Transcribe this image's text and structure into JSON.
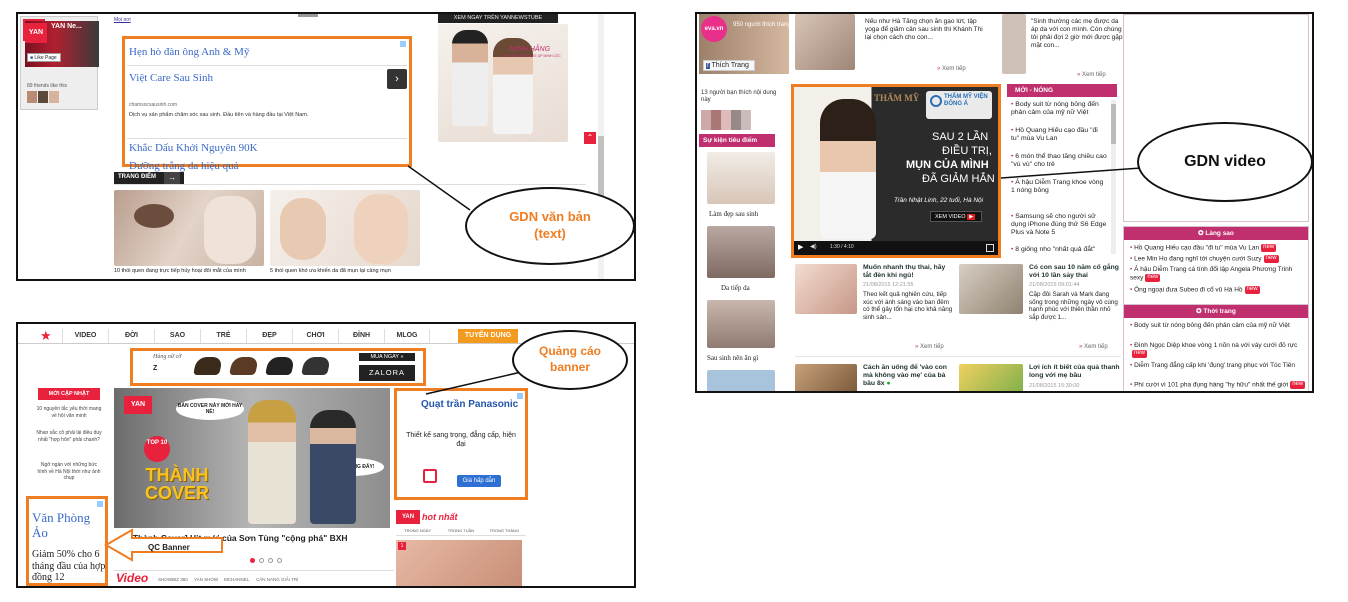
{
  "p1": {
    "fb_name": "YAN Ne...",
    "like_label": "Like Page",
    "friends": "89 friends like this",
    "top_link": "Mọi nơi",
    "banner_text": "XEM NGAY TRÊN YANNEWSTUBE",
    "ad_items": [
      "Hẹn hò đàn ông Anh & Mỹ",
      "Việt Care Sau Sinh",
      "Khắc Dấu Khởi Nguyên 90K",
      "Dưỡng trắng da hiệu quả"
    ],
    "ad_url": "chamsocsausinh.com",
    "ad_desc": "Dịch vụ sản phẩm chăm sóc sau sinh. Đầu tiên và hàng đầu tại Việt Nam.",
    "promo_name": "MINH HẰNG",
    "promo_sub": "CHUYÊN VIÊN MAKE UP MINH LỘC",
    "section": "TRANG ĐIỂM",
    "article1": "10 thói quen đang trực tiếp hủy hoại đôi mắt của mình",
    "article2": "5 thói quen khó ưa khiến da đã mụn lại càng mụn",
    "callout": "GDN văn bản (text)"
  },
  "p2": {
    "logo": "eva.vn",
    "follow": "950 người thích trang",
    "like_btn": "Thích Trang",
    "likes_text": "13 người bạn thích nội dung này",
    "top_text1": "Nếu như Hà Tăng chọn ăn gạo lứt, tập yoga để giảm cân sau sinh thì Khánh Thi lại chọn cách cho con...",
    "top_text2": "\"Sinh thường các mẹ được da áp da với con mình. Còn chúng tôi phải đợi 2 giờ mới được gặp mặt con...",
    "see_more": "Xem tiếp",
    "side_head": "Sự kiện tiêu điểm",
    "side_items": [
      "Làm đẹp sau sinh",
      "Da tiếp da",
      "Sau sinh nên ăn gì"
    ],
    "video_brand": "THẨM MỸ VIỆN ĐÔNG Á",
    "video_lines": [
      "SAU 2 LẦN",
      "ĐIỀU TRỊ,",
      "MỤN CỦA MÌNH",
      "ĐÃ GIẢM HẲN"
    ],
    "video_name": "Trần Nhật Linh, 22 tuổi, Hà Nội",
    "video_btn": "XEM VIDEO",
    "video_time": "1:30 / 4:10",
    "news_head": "MỚI - NÓNG",
    "news": [
      "Body suit từ nóng bỏng đến phản cảm của mỹ nữ Việt",
      "Hồ Quang Hiếu cạo đầu \"đi tu\" mùa Vu Lan",
      "6 món thể thao tăng chiều cao \"vù vù\" cho trẻ",
      "Á hậu Diễm Trang khoe vòng 1 nóng bỏng",
      "Samsung sẽ cho người sử dụng iPhone đúng thử S6 Edge Plus và Note 5",
      "8 giống nho \"nhất quả đắt\""
    ],
    "bottom_titles": [
      "Muốn nhanh thụ thai, hãy tắt đèn khi ngủ!",
      "Có con sau 10 năm cố gắng với 10 lần sảy thai",
      "Cách ăn uống để 'vào con mà không vào mẹ' của bà bầu 8x",
      "Lợi ích ít biết của quả thanh long với mẹ bầu"
    ],
    "bottom_dates": [
      "21/08/2015 12:21:55",
      "21/08/2015 09:01:44",
      "21/08/2015 15:30:00",
      "21/08/2015 15:30:00"
    ],
    "bottom_descs": [
      "Theo kết quả nghiên cứu, tiếp xúc với ánh sáng vào ban đêm có thể gây tổn hại cho khả năng sinh sản...",
      "Cặp đôi Sarah và Mark đang sống trong những ngày vô cùng hạnh phúc với thiên thần nhỏ sắp được 1..."
    ],
    "box1_head": "Làng sao",
    "box1_items": [
      "Hồ Quang Hiếu cạo đầu \"đi tu\" mùa Vu Lan",
      "Lee Min Ho đang nghĩ tới chuyện cưới Suzy",
      "Á hậu Diễm Trang cá tính đổi lập Angela Phương Trinh sexy",
      "Ông ngoại đưa Subeo đi cổ vũ Hà Hồ"
    ],
    "box2_head": "Thời trang",
    "box2_items": [
      "Body suit từ nóng bỏng đến phản cảm của mỹ nữ Việt",
      "Đình Ngọc Diệp khoe vòng 1 nõn nà với váy cưới đỏ rực",
      "Diễm Trang đẳng cấp khi 'đụng' trang phục với Tóc Tiên",
      "Phí cười vì 101 pha đụng hàng \"hy hữu\" nhất thế giới"
    ],
    "new_tag": "new",
    "callout": "GDN video"
  },
  "p3": {
    "nav": [
      "VIDEO",
      "ĐỜI",
      "SAO",
      "TRẺ",
      "ĐẸP",
      "CHƠI",
      "ĐỈNH",
      "MLOG",
      "TUYỂN DỤNG"
    ],
    "banner_script": "Hàng nữ cỡ",
    "banner_brand": "ZALORA",
    "banner_cta": "MUA NGAY »",
    "side_head": "MỚI CẬP NHẬT",
    "side_items": [
      "10 nguyên tắc yêu thời mang về hội văn minh",
      "Nhan sắc cô phải lái điều duy nhất \"hợp hôn\" phải chanh?",
      "Ngỡ ngàn với những bức hình về Hà Nội thời như ảnh chụp"
    ],
    "left_ad_title": "Văn Phòng Ảo",
    "left_ad_desc": "Giảm 50% cho 6 tháng đầu của hợp đồng 12",
    "feature_bubble1": "BẢN COVER NÀY MỚI HAY NÈ!",
    "feature_bubble2": "THẬT KHÔNG ĐẤY!",
    "feature_top": "TOP 10",
    "feature_title": "THÀNH COVER",
    "feature_caption": "[Thành Cover] Hit mới của Sơn Tùng \"cộng phá\" BXH cover",
    "video_label": "Video",
    "video_tabs": [
      "SHOWBIZ 360",
      "YAN SHOW",
      "MCHANNEL",
      "CĂN NANG GIẢI TRÍ"
    ],
    "right_ad_title": "Quạt trần Panasonic",
    "right_ad_desc": "Thiết kế sang trọng, đẳng cấp, hiện đại",
    "right_ad_btn": "Giá hấp dẫn",
    "hot_label": "hot nhất",
    "hot_tabs": [
      "TRONG NGÀY",
      "TRONG TUẦN",
      "TRONG THÁNG"
    ],
    "qc_label": "QC Banner",
    "callout": "Quảng cáo banner"
  }
}
